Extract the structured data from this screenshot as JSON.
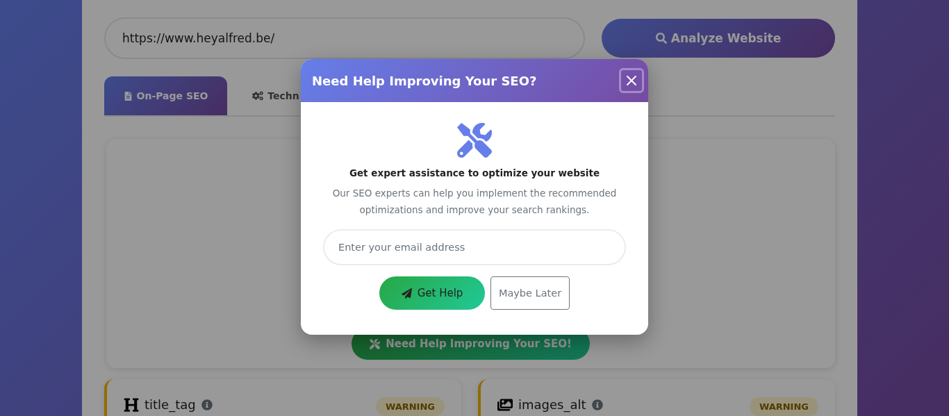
{
  "url_field": {
    "value": "https://www.heyalfred.be/"
  },
  "analyze_button": {
    "label": "Analyze Website"
  },
  "tabs": [
    {
      "label": "On-Page SEO",
      "kind": "page",
      "selected": true
    },
    {
      "label": "Techn",
      "kind": "technical",
      "selected": false
    }
  ],
  "summary_card": {
    "help_button": {
      "label": "Need Help Improving Your SEO!"
    }
  },
  "checks": [
    {
      "name": "title_tag",
      "kind": "heading",
      "status": "WARNING"
    },
    {
      "name": "images_alt",
      "kind": "images",
      "status": "WARNING"
    }
  ],
  "modal": {
    "title": "Need Help Improving Your SEO?",
    "heading": "Get expert assistance to optimize your website",
    "text": "Our SEO experts can help you implement the recommended optimizations and improve your search rankings.",
    "email_field": {
      "placeholder": "Enter your email address"
    },
    "primary_button": {
      "label": "Get Help"
    },
    "secondary_button": {
      "label": "Maybe Later"
    }
  }
}
